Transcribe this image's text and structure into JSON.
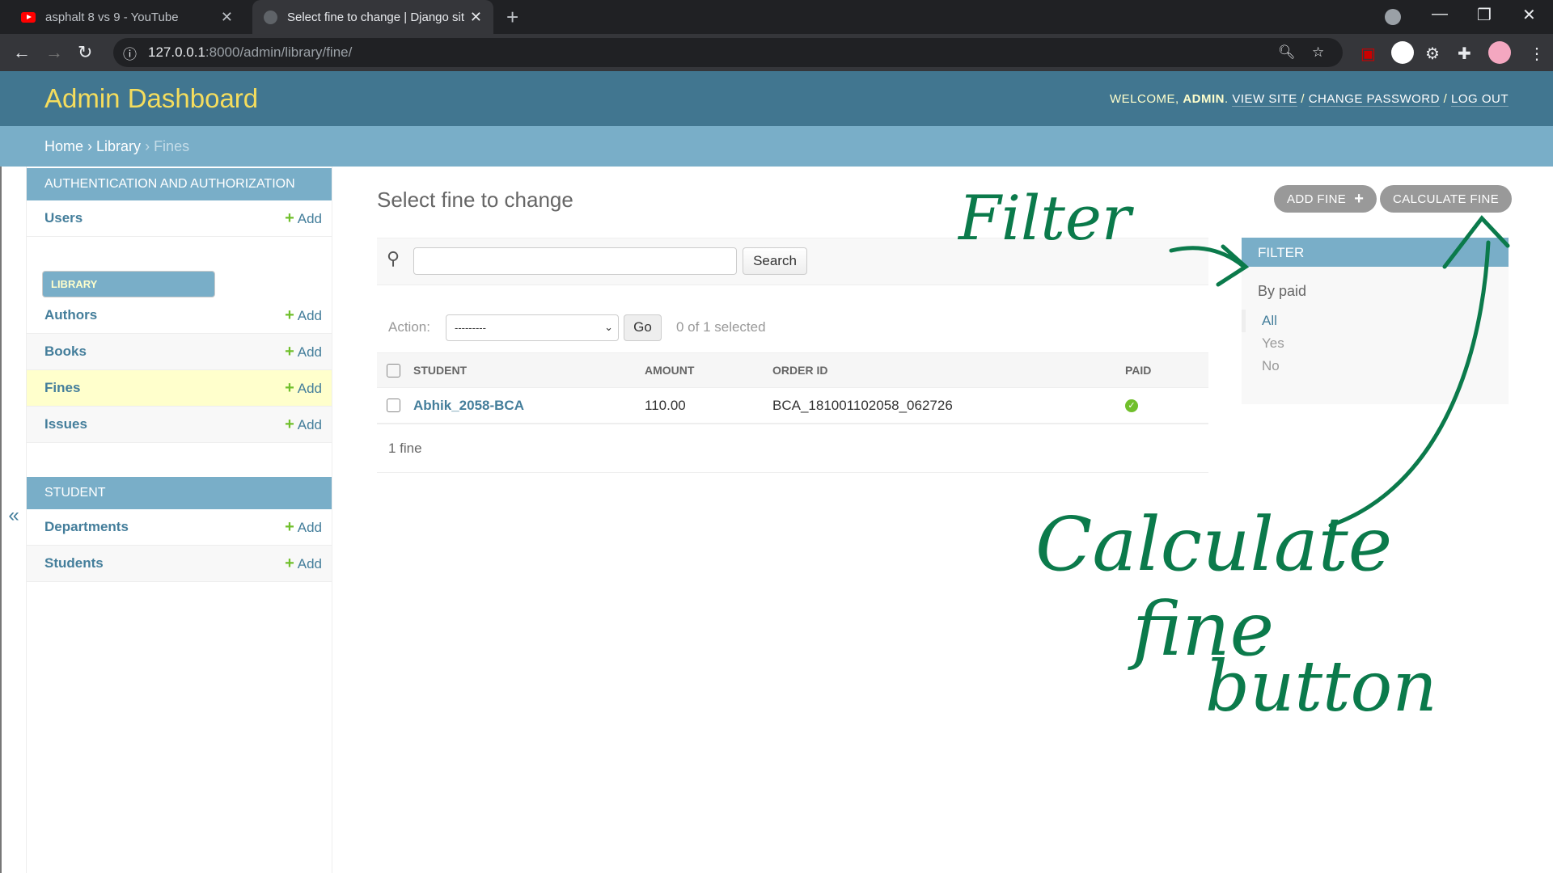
{
  "browser": {
    "tabs": [
      {
        "title": "asphalt 8 vs 9 - YouTube",
        "icon": "youtube-icon"
      },
      {
        "title": "Select fine to change | Django sit",
        "icon": "globe-icon",
        "active": true
      }
    ],
    "url_host": "127.0.0.1",
    "url_rest": ":8000/admin/library/fine/"
  },
  "header": {
    "brand": "Admin Dashboard",
    "welcome": "WELCOME, ",
    "user": "ADMIN",
    "view_site": "VIEW SITE",
    "change_password": "CHANGE PASSWORD",
    "logout": "LOG OUT",
    "sep": " / "
  },
  "breadcrumbs": {
    "home": "Home",
    "library": "Library",
    "current": "Fines"
  },
  "sidebar": {
    "toggle": "«",
    "add_label": "Add",
    "modules": [
      {
        "title": "AUTHENTICATION AND AUTHORIZATION",
        "items": [
          "Users"
        ]
      },
      {
        "title": "LIBRARY",
        "items": [
          "Authors",
          "Books",
          "Fines",
          "Issues"
        ]
      },
      {
        "title": "STUDENT",
        "items": [
          "Departments",
          "Students"
        ]
      }
    ]
  },
  "main": {
    "title": "Select fine to change",
    "add_button": "ADD FINE",
    "calculate_button": "CALCULATE FINE",
    "search_button": "Search",
    "search_value": "",
    "action_label": "Action:",
    "action_selected": "---------",
    "go": "Go",
    "selected_count": "0 of 1 selected",
    "columns": [
      "STUDENT",
      "AMOUNT",
      "ORDER ID",
      "PAID"
    ],
    "rows": [
      {
        "student": "Abhik_2058-BCA",
        "amount": "110.00",
        "order_id": "BCA_181001102058_062726",
        "paid": true
      }
    ],
    "paginator": "1 fine"
  },
  "filter": {
    "title": "FILTER",
    "by": "By paid",
    "options": [
      "All",
      "Yes",
      "No"
    ],
    "selected": "All"
  },
  "annotations": {
    "filter": "Filter",
    "calc_line1": "Calculate",
    "calc_line2": "fine",
    "calc_line3": "button",
    "color": "#0b7a4b"
  }
}
